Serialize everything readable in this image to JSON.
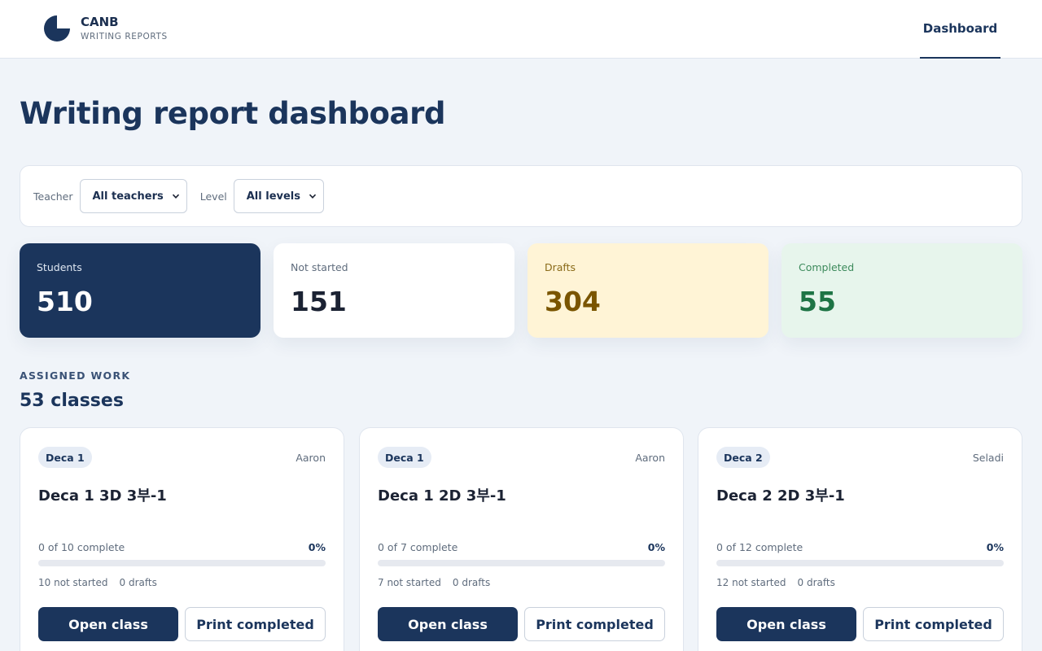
{
  "brand": {
    "name": "CANB",
    "subtitle": "WRITING REPORTS"
  },
  "nav": {
    "dashboard": "Dashboard"
  },
  "page_title": "Writing report dashboard",
  "filters": {
    "teacher_label": "Teacher",
    "teacher_value": "All teachers",
    "level_label": "Level",
    "level_value": "All levels"
  },
  "stats": {
    "students": {
      "label": "Students",
      "value": "510"
    },
    "not_started": {
      "label": "Not started",
      "value": "151"
    },
    "drafts": {
      "label": "Drafts",
      "value": "304"
    },
    "completed": {
      "label": "Completed",
      "value": "55"
    }
  },
  "section": {
    "kicker": "ASSIGNED WORK",
    "title": "53 classes"
  },
  "classes": [
    {
      "level": "Deca 1",
      "teacher": "Aaron",
      "name": "Deca 1 3D 3부-1",
      "progress_text": "0 of 10 complete",
      "percent_label": "0%",
      "progress": 0,
      "not_started": "10 not started",
      "drafts": "0 drafts",
      "open_label": "Open class",
      "print_label": "Print completed"
    },
    {
      "level": "Deca 1",
      "teacher": "Aaron",
      "name": "Deca 1 2D 3부-1",
      "progress_text": "0 of 7 complete",
      "percent_label": "0%",
      "progress": 0,
      "not_started": "7 not started",
      "drafts": "0 drafts",
      "open_label": "Open class",
      "print_label": "Print completed"
    },
    {
      "level": "Deca 2",
      "teacher": "Seladi",
      "name": "Deca 2 2D 3부-1",
      "progress_text": "0 of 12 complete",
      "percent_label": "0%",
      "progress": 0,
      "not_started": "12 not started",
      "drafts": "0 drafts",
      "open_label": "Open class",
      "print_label": "Print completed"
    }
  ],
  "colors": {
    "primary": "#1b355c",
    "drafts_bg": "#fff4d6",
    "completed_bg": "#e7f5ec",
    "page_bg": "#f0f4f9"
  },
  "icons": {
    "logo": "pie-chart-logo-icon",
    "select": "chevron-down-icon"
  }
}
